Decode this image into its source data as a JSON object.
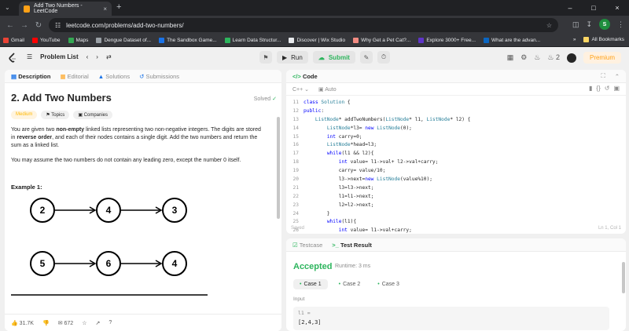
{
  "browser": {
    "tab_title": "Add Two Numbers - LeetCode",
    "url": "leetcode.com/problems/add-two-numbers/",
    "profile_initial": "S",
    "bookmarks": [
      "Gmail",
      "YouTube",
      "Maps",
      "Dengue Dataset of...",
      "The Sandbox Game...",
      "Learn Data Structur...",
      "Discover | Wix Studio",
      "Why Get a Pet Cat?...",
      "Explore 3000+ Free...",
      "What are the advan..."
    ],
    "all_bookmarks": "All Bookmarks"
  },
  "header": {
    "problem_list": "Problem List",
    "run": "Run",
    "submit": "Submit",
    "streak": "2",
    "premium": "Premium"
  },
  "left": {
    "tabs": [
      "Description",
      "Editorial",
      "Solutions",
      "Submissions"
    ],
    "title": "2. Add Two Numbers",
    "solved": "Solved",
    "difficulty": "Medium",
    "chip_topics": "Topics",
    "chip_companies": "Companies",
    "para1_a": "You are given two ",
    "para1_b": "non-empty",
    "para1_c": " linked lists representing two non-negative integers. The digits are stored in ",
    "para1_d": "reverse order",
    "para1_e": ", and each of their nodes contains a single digit. Add the two numbers and return the sum as a linked list.",
    "para2": "You may assume the two numbers do not contain any leading zero, except the number 0 itself.",
    "example_label": "Example 1:",
    "diagram_row1": [
      "2",
      "4",
      "3"
    ],
    "diagram_row2": [
      "5",
      "6",
      "4"
    ],
    "likes": "31.7K",
    "comments": "672"
  },
  "code": {
    "title": "Code",
    "language": "C++",
    "mode": "Auto",
    "status_left": "Saved",
    "status_right": "Ln 1, Col 1",
    "lines": [
      {
        "n": "11",
        "t": "class Solution {"
      },
      {
        "n": "12",
        "t": "public:"
      },
      {
        "n": "13",
        "t": "    ListNode* addTwoNumbers(ListNode* l1, ListNode* l2) {"
      },
      {
        "n": "14",
        "t": "        ListNode*l3= new ListNode(0);"
      },
      {
        "n": "15",
        "t": "        int carry=0;"
      },
      {
        "n": "16",
        "t": "        ListNode*head=l3;"
      },
      {
        "n": "17",
        "t": "        while(l1 && l2){"
      },
      {
        "n": "18",
        "t": "            int value= l1->val+ l2->val+carry;"
      },
      {
        "n": "19",
        "t": "            carry= value/10;"
      },
      {
        "n": "20",
        "t": "            l3->next=new ListNode(value%10);"
      },
      {
        "n": "21",
        "t": "            l3=l3->next;"
      },
      {
        "n": "22",
        "t": "            l1=l1->next;"
      },
      {
        "n": "23",
        "t": "            l2=l2->next;"
      },
      {
        "n": "24",
        "t": "        }"
      },
      {
        "n": "25",
        "t": "        while(l1){"
      },
      {
        "n": "26",
        "t": "            int value= l1->val+carry;"
      }
    ]
  },
  "test": {
    "tab_testcase": "Testcase",
    "tab_result": "Test Result",
    "status": "Accepted",
    "runtime": "Runtime: 3 ms",
    "cases": [
      "Case 1",
      "Case 2",
      "Case 3"
    ],
    "input_label": "Input",
    "var_name": "l1 =",
    "var_value": "[2,4,3]"
  },
  "colors": {
    "accent_orange": "#ffa116",
    "accepted_green": "#2db55d",
    "keyword_blue": "#0000ff",
    "type_teal": "#267f99"
  }
}
